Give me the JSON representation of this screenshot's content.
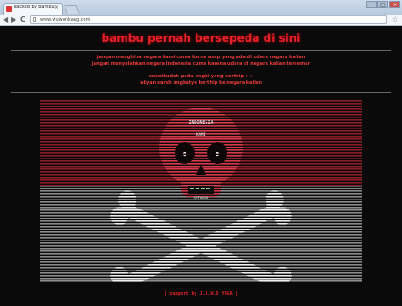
{
  "browser": {
    "tab_title": "hacked by bambu",
    "tab_close": "×",
    "url": "www.wuwankang.com",
    "back": "◀",
    "forward": "▶",
    "reload": "C",
    "star": "☆",
    "minimize": "–",
    "maximize": "□",
    "close": "×"
  },
  "page": {
    "title": "bambu pernah bersepeda di sini",
    "message_lines": [
      "jangan menghina negara kami cuma karna asap yang ada di udara negara kalian",
      "jangan menyalahkan negara Indonesia cuma karena udara di negara kalian tercemar"
    ],
    "sign_lines": [
      "sobatkudah pada ungki yang berthip ++",
      "abyan sarah angkatyu berthip ke negara kalian"
    ],
    "skull_label": "INDONESIA",
    "skull_label2": "KAMI",
    "teeth_label": "GOTANZA",
    "footer": "[ support by J.A.W.O  YOGA ]",
    "colors": {
      "accent": "#e5202a",
      "skull_red": "#c0303a",
      "bones_white": "#e6e6e6"
    }
  }
}
